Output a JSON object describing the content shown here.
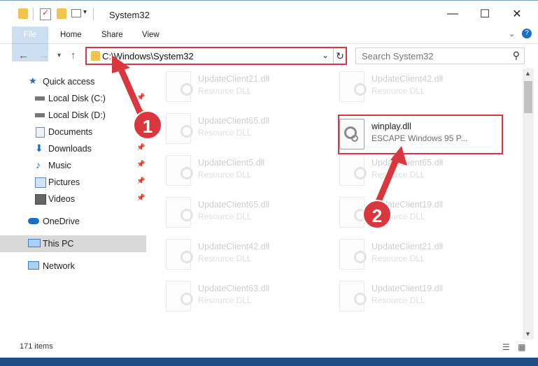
{
  "window": {
    "title": "System32",
    "controls": {
      "minimize": "—",
      "maximize": "☐",
      "close": "✕"
    }
  },
  "ribbon": {
    "tabs": [
      "File",
      "Home",
      "Share",
      "View"
    ]
  },
  "address": {
    "path": "C:\\Windows\\System32"
  },
  "search": {
    "placeholder": "Search System32"
  },
  "sidebar": {
    "items": [
      {
        "label": "Quick access"
      },
      {
        "label": "Local Disk (C:)"
      },
      {
        "label": "Local Disk (D:)"
      },
      {
        "label": "Documents"
      },
      {
        "label": "Downloads"
      },
      {
        "label": "Music"
      },
      {
        "label": "Pictures"
      },
      {
        "label": "Videos"
      },
      {
        "label": "OneDrive"
      },
      {
        "label": "This PC"
      },
      {
        "label": "Network"
      }
    ]
  },
  "files": [
    {
      "name": "UpdateClient21.dll",
      "desc": "Resource DLL"
    },
    {
      "name": "UpdateClient42.dll",
      "desc": "Resource DLL"
    },
    {
      "name": "UpdateClient65.dll",
      "desc": "Resource DLL"
    },
    {
      "name": "winplay.dll",
      "desc": "ESCAPE Windows 95 P..."
    },
    {
      "name": "UpdateClient5.dll",
      "desc": "Resource DLL"
    },
    {
      "name": "UpdateClient65.dll",
      "desc": "Resource DLL"
    },
    {
      "name": "UpdateClient65.dll",
      "desc": "Resource DLL"
    },
    {
      "name": "UpdateClient19.dll",
      "desc": "Resource DLL"
    },
    {
      "name": "UpdateClient42.dll",
      "desc": "Resource DLL"
    },
    {
      "name": "UpdateClient21.dll",
      "desc": "Resource DLL"
    },
    {
      "name": "UpdateClient63.dll",
      "desc": "Resource DLL"
    },
    {
      "name": "UpdateClient19.dll",
      "desc": "Resource DLL"
    }
  ],
  "status": {
    "item_count": "171 items"
  },
  "annotations": {
    "step1": "1",
    "step2": "2",
    "color": "#d9363e"
  }
}
